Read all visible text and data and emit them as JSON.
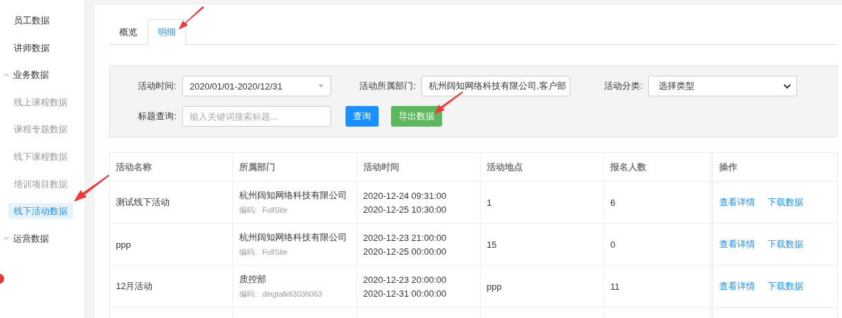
{
  "sidebar": {
    "items": [
      {
        "kind": "item",
        "label": "员工数据",
        "selected": false
      },
      {
        "kind": "item",
        "label": "讲师数据",
        "selected": false
      },
      {
        "kind": "group",
        "label": "业务数据",
        "expanded": true,
        "children": [
          {
            "label": "线上课程数据",
            "selected": false
          },
          {
            "label": "课程专题数据",
            "selected": false
          },
          {
            "label": "线下课程数据",
            "selected": false
          },
          {
            "label": "培训项目数据",
            "selected": false
          },
          {
            "label": "线下活动数据",
            "selected": true
          }
        ]
      },
      {
        "kind": "group",
        "label": "运营数据",
        "expanded": false
      }
    ]
  },
  "tabs": [
    {
      "label": "概览",
      "selected": false
    },
    {
      "label": "明细",
      "selected": true
    }
  ],
  "filters": {
    "fields": [
      {
        "kind": "date",
        "label": "活动时间:",
        "value": "2020/01/01-2020/12/31"
      },
      {
        "kind": "text",
        "label": "活动所属部门:",
        "value": "杭州阔知网络科技有限公司,客户部"
      },
      {
        "kind": "select",
        "label": "活动分类:",
        "value": "选择类型"
      },
      {
        "kind": "search",
        "label": "标题查询:",
        "placeholder": "输入关键词搜索标题..."
      }
    ],
    "buttons": [
      {
        "kind": "primary",
        "label": "查询"
      },
      {
        "kind": "success",
        "label": "导出数据"
      }
    ]
  },
  "table": {
    "columns": [
      "活动名称",
      "所属部门",
      "活动时间",
      "活动地点",
      "报名人数",
      "操作"
    ],
    "rows": [
      {
        "name": "测试线下活动",
        "department": "杭州阔知网络科技有限公司",
        "code_label": "编码:",
        "code": "FullSite",
        "start": "2020-12-24 09:31:00",
        "end": "2020-12-25 10:30:00",
        "location": "1",
        "count": "6",
        "actions": [
          "查看详情",
          "下载数据"
        ]
      },
      {
        "name": "ppp",
        "department": "杭州阔知网络科技有限公司",
        "code_label": "编码:",
        "code": "FullSite",
        "start": "2020-12-23 21:00:00",
        "end": "2020-12-25 00:00:00",
        "location": "15",
        "count": "0",
        "actions": [
          "查看详情",
          "下载数据"
        ]
      },
      {
        "name": "12月活动",
        "department": "质控部",
        "code_label": "编码:",
        "code": "dingtalk63036063",
        "start": "2020-12-23 20:00:00",
        "end": "2020-12-31 00:00:00",
        "location": "ppp",
        "count": "11",
        "actions": [
          "查看详情",
          "下载数据"
        ]
      }
    ]
  }
}
